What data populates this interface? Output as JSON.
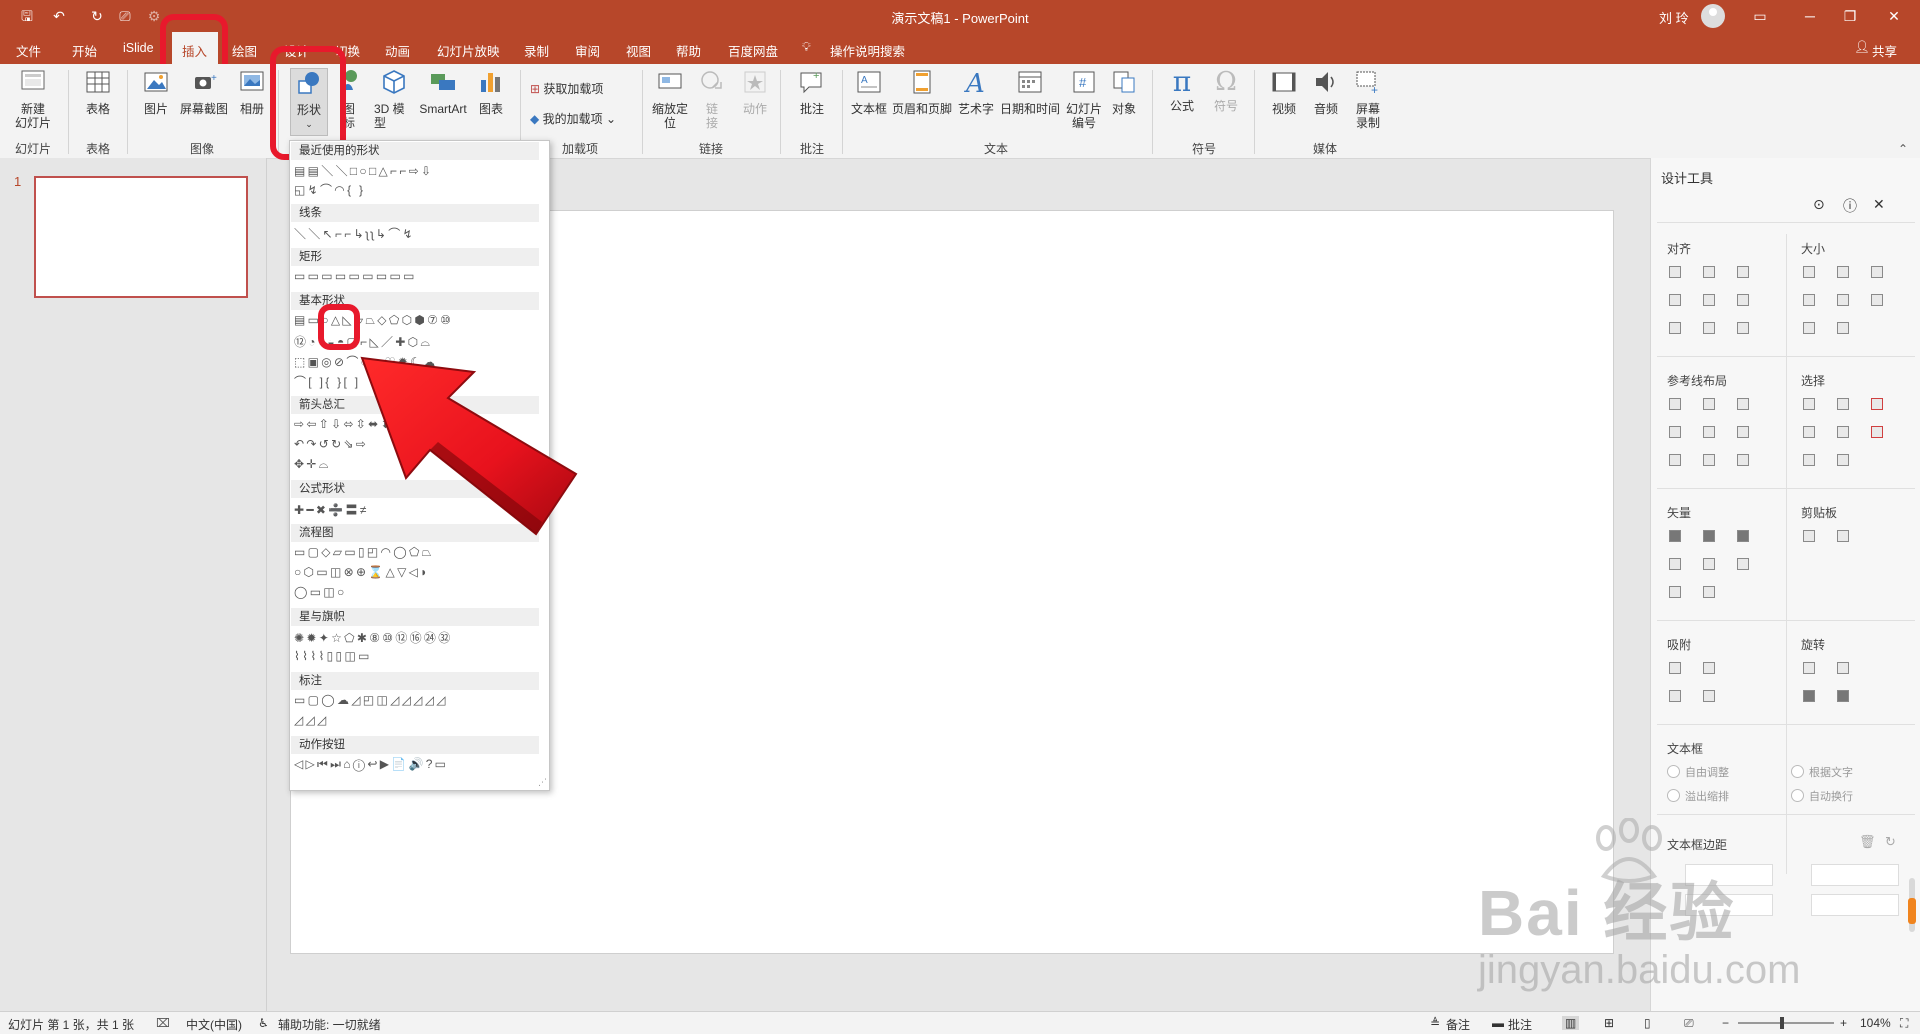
{
  "colors": {
    "accent": "#b7472a",
    "highlight": "#e8192c",
    "arrow": "#e8121d"
  },
  "titlebar": {
    "doc_title": "演示文稿1  -  PowerPoint",
    "user": "刘 玲",
    "icons": [
      "save-icon",
      "undo-icon",
      "redo-icon",
      "present-icon",
      "share-icon"
    ]
  },
  "menu": {
    "tabs": [
      "文件",
      "开始",
      "iSlide",
      "插入",
      "绘图",
      "设计",
      "切换",
      "动画",
      "幻灯片放映",
      "录制",
      "审阅",
      "视图",
      "帮助",
      "百度网盘"
    ],
    "tell_me": "操作说明搜索",
    "share": "共享"
  },
  "ribbon": {
    "new_slide": "新建\n幻灯片",
    "table": "表格",
    "picture": "图片",
    "screenshot": "屏幕截图",
    "album": "相册",
    "shapes": "形状",
    "icons": "图\n标",
    "model3d": "3D 模\n型",
    "smartart": "SmartArt",
    "chart": "图表",
    "get_addins": "获取加载项",
    "my_addins": "我的加载项",
    "zoom": "缩放定\n位",
    "link": "链\n接",
    "action": "动作",
    "comment": "批注",
    "textbox": "文本框",
    "header_footer": "页眉和页脚",
    "wordart": "艺术字",
    "datetime": "日期和时间",
    "slide_number": "幻灯片\n编号",
    "object": "对象",
    "equation": "公式",
    "symbol": "符号",
    "video": "视频",
    "audio": "音频",
    "screen_record": "屏幕\n录制",
    "groups": {
      "slides": "幻灯片",
      "tables": "表格",
      "images": "图像",
      "addins": "加载项",
      "links": "链接",
      "comments": "批注",
      "text": "文本",
      "symbols": "符号",
      "media": "媒体"
    }
  },
  "slides_panel": {
    "number": "1"
  },
  "shape_menu": {
    "sections": [
      "最近使用的形状",
      "线条",
      "矩形",
      "基本形状",
      "箭头总汇",
      "公式形状",
      "流程图",
      "星与旗帜",
      "标注",
      "动作按钮"
    ],
    "rows": {
      "recent1": "▤▤＼＼□○□△⌐⌐⇨⇩",
      "recent2": "◱↯⌒◠{ }",
      "lines": "＼＼↖⌐⌐↳ʅʅ↳⌒↯",
      "rect": "▭▭▭▭▭▭▭▭▭",
      "basic1": "▤▭○△◺▱⏢◇⬠⬡⬢⑦⑩",
      "basic2": "⑫◔◑◒◓▢⌐◺／✚⬡⌓",
      "basic3": "⬚▣◎⊘⌒◌☺♡✹☾☁",
      "basic4": "⌒[ ]{ }[ ]",
      "arrows1": "⇨⇦⇧⇩⬄⇳⬌⬍⇧",
      "arrows2": "↶↷↺↻⇘⇨",
      "arrows3": "✥✛⌓",
      "formula": "✚━✖➗〓≠",
      "flow1": "▭▢◇▱▭▯◰◠◯⬠⏢",
      "flow2": "○⬡▭◫⊗⊕⌛△▽◁◗",
      "flow3": "◯▭◫○",
      "stars1": "✺✹✦☆⬠✱⑧⑩⑫⑯㉔㉜",
      "stars2": "⌇⌇⌇⌇▯▯◫▭",
      "callout1": "▭▢◯☁◿◰◫◿◿◿◿◿",
      "callout2": "◿◿◿",
      "actions": "◁▷⏮⏭⌂ⓘ↩▶📄🔊?▭"
    }
  },
  "design_pane": {
    "title": "设计工具",
    "sections": {
      "align": "对齐",
      "size": "大小",
      "guides": "参考线布局",
      "select": "选择",
      "vector": "矢量",
      "clipboard": "剪贴板",
      "snap": "吸附",
      "rotate": "旋转",
      "textbox": "文本框",
      "textbox_margin": "文本框边距"
    },
    "options": {
      "auto_adjust": "自由调整",
      "overflow": "溢出缩排",
      "by_text": "根据文字",
      "auto_wrap": "自动换行"
    }
  },
  "statusbar": {
    "slide_info": "幻灯片 第 1 张，共 1 张",
    "language": "中文(中国)",
    "accessibility": "辅助功能: 一切就绪",
    "notes": "备注",
    "comments": "批注",
    "zoom": "104%"
  },
  "watermark": {
    "main": "Bai 经验",
    "sub": "jingyan.baidu.com"
  }
}
